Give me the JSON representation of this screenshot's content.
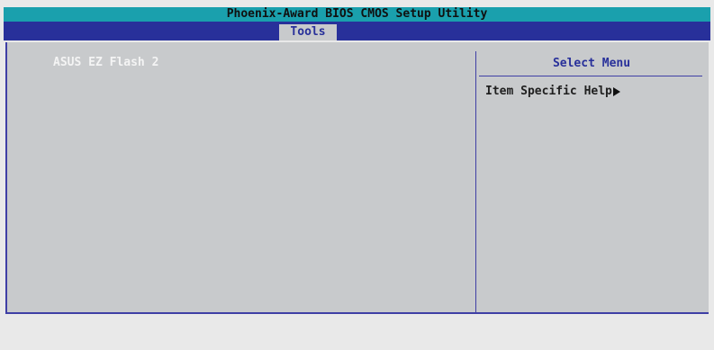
{
  "title_bar": "Phoenix-Award BIOS CMOS Setup Utility",
  "menu": {
    "active_tab": "Tools"
  },
  "main": {
    "items": [
      {
        "label": "ASUS EZ Flash 2"
      }
    ]
  },
  "help_panel": {
    "title": "Select Menu",
    "item_specific_help": "Item Specific Help"
  },
  "colors": {
    "title_bg": "#1aa0ad",
    "menu_bg": "#28309a",
    "panel_bg": "#c8cacc"
  },
  "icons": {
    "help_arrow": "triangle-right-icon"
  }
}
